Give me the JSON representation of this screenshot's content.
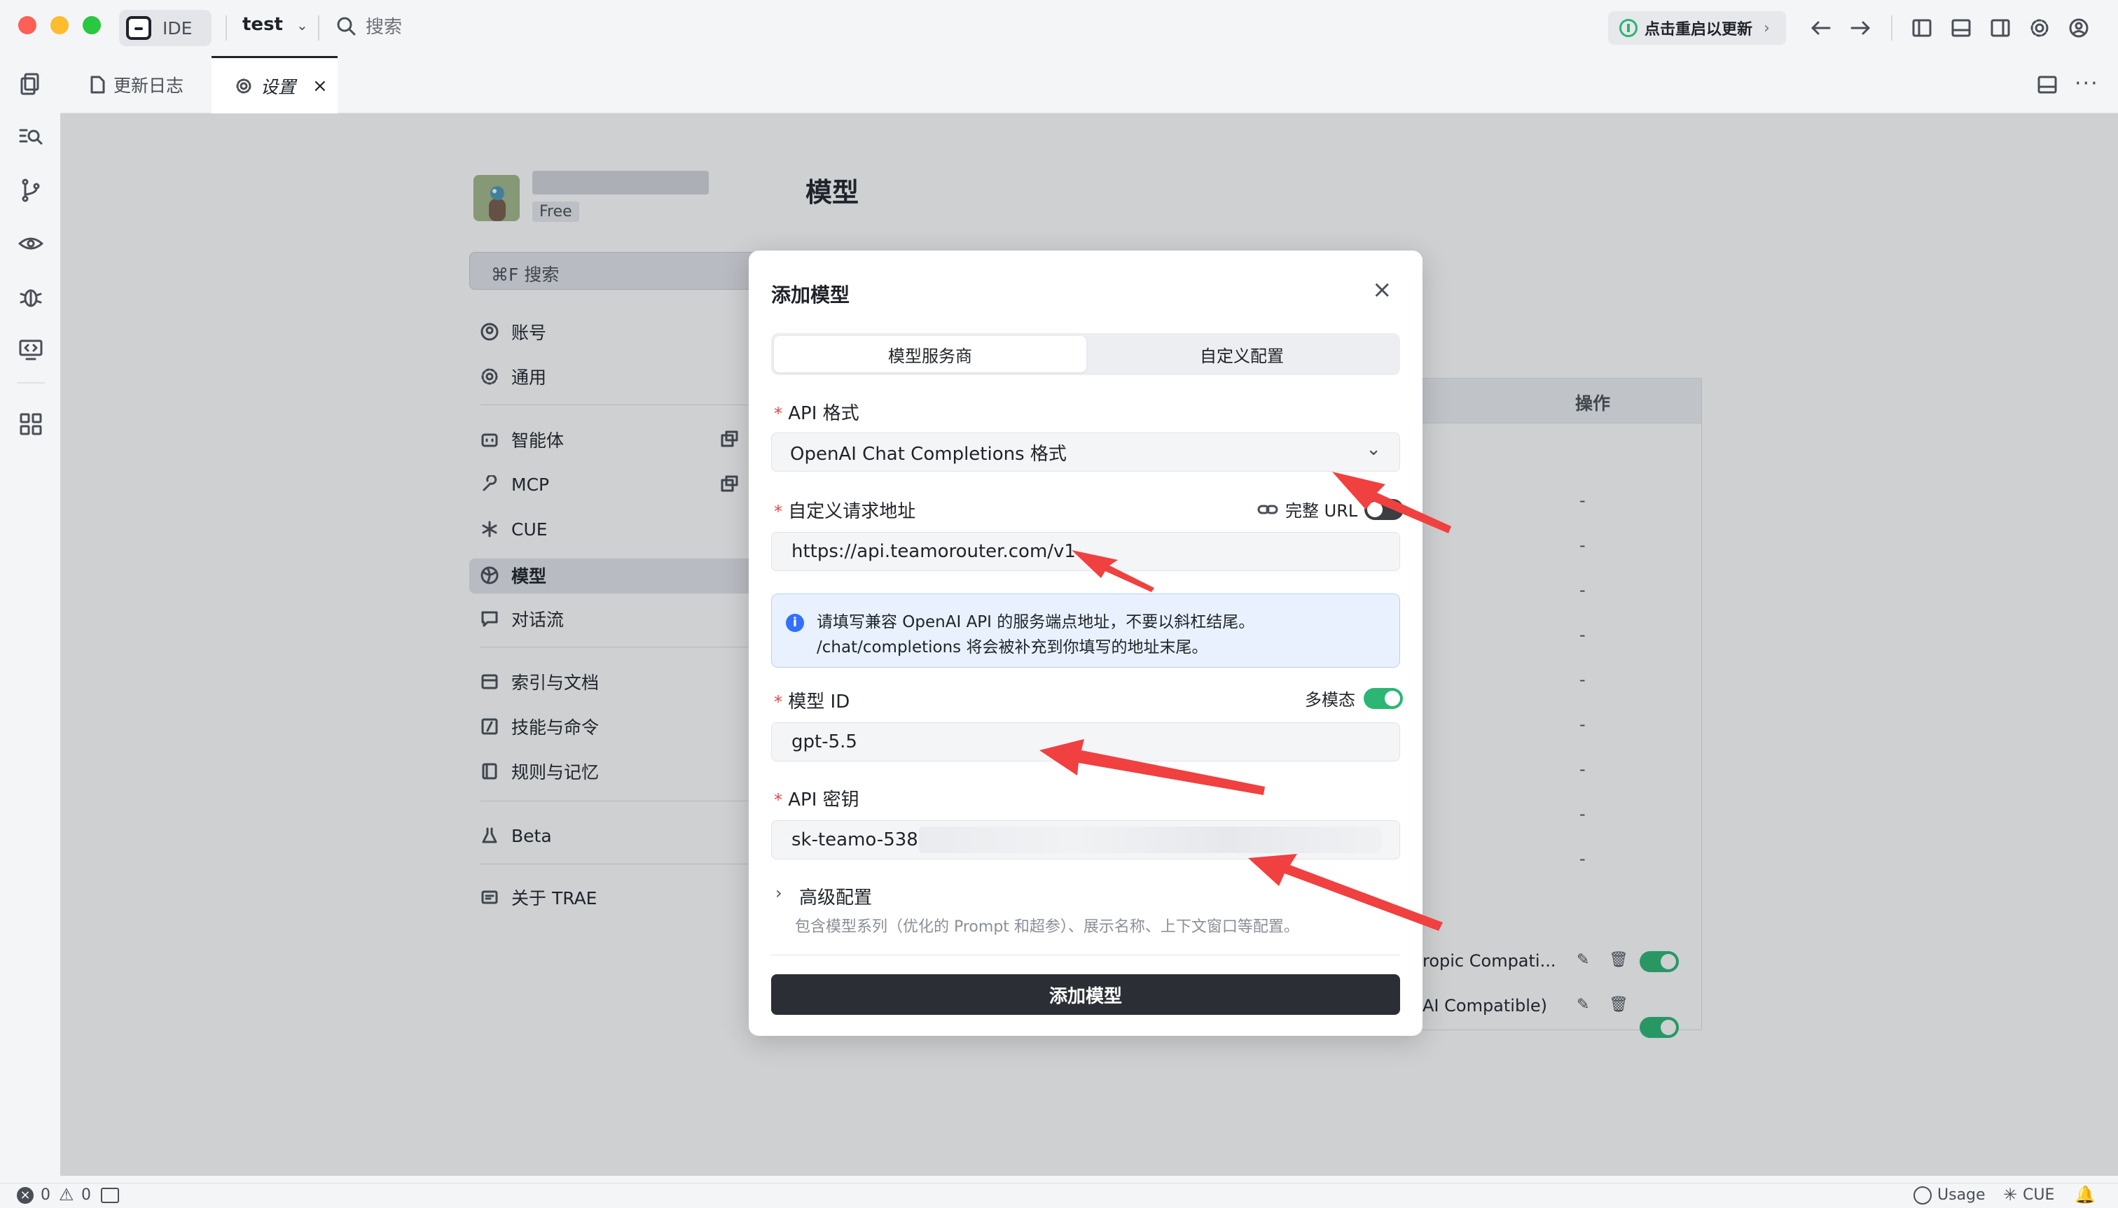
{
  "app": {
    "name": "IDE",
    "project": "test",
    "search_label": "搜索",
    "update_label": "点击重启以更新"
  },
  "tabs": [
    {
      "label": "更新日志"
    },
    {
      "label": "设置"
    }
  ],
  "profile": {
    "plan": "Free"
  },
  "settings": {
    "search": "⌘F 搜索",
    "nav": [
      {
        "label": "账号",
        "icon": "user-circle-icon"
      },
      {
        "label": "通用",
        "icon": "gear-icon"
      },
      {
        "label": "智能体",
        "icon": "bot-icon"
      },
      {
        "label": "MCP",
        "icon": "wrench-icon"
      },
      {
        "label": "CUE",
        "icon": "sparkle-icon"
      },
      {
        "label": "模型",
        "icon": "globe-icon"
      },
      {
        "label": "对话流",
        "icon": "chat-icon"
      },
      {
        "label": "索引与文档",
        "icon": "database-icon"
      },
      {
        "label": "技能与命令",
        "icon": "slash-icon"
      },
      {
        "label": "规则与记忆",
        "icon": "book-icon"
      },
      {
        "label": "Beta",
        "icon": "flask-icon"
      },
      {
        "label": "关于 TRAE",
        "icon": "info-card-icon"
      }
    ]
  },
  "page": {
    "title": "模型",
    "table_header": "操作",
    "dash": "-",
    "row_label_1": "ropic Compati...",
    "row_label_2": "AI Compatible)"
  },
  "modal": {
    "title": "添加模型",
    "tab_provider": "模型服务商",
    "tab_custom": "自定义配置",
    "api_format_label": "API 格式",
    "api_format_value": "OpenAI Chat Completions 格式",
    "url_label": "自定义请求地址",
    "full_url_label": "完整 URL",
    "full_url_enabled": false,
    "url_value": "https://api.teamorouter.com/v1",
    "info_line1": "请填写兼容 OpenAI API 的服务端点地址，不要以斜杠结尾。",
    "info_line2": "/chat/completions 将会被补充到你填写的地址末尾。",
    "model_id_label": "模型 ID",
    "multimodal_label": "多模态",
    "multimodal_enabled": true,
    "model_id_value": "gpt-5.5",
    "api_key_label": "API 密钥",
    "api_key_value": "sk-teamo-538",
    "advanced_label": "高级配置",
    "advanced_desc": "包含模型系列（优化的 Prompt 和超参）、展示名称、上下文窗口等配置。",
    "submit_label": "添加模型"
  },
  "status": {
    "errors": "0",
    "warnings": "0",
    "usage_label": "Usage",
    "cue_label": "CUE"
  },
  "colors": {
    "accent_green": "#2bb673",
    "arrow_red": "#f04040",
    "primary_button": "#2b2f35"
  }
}
